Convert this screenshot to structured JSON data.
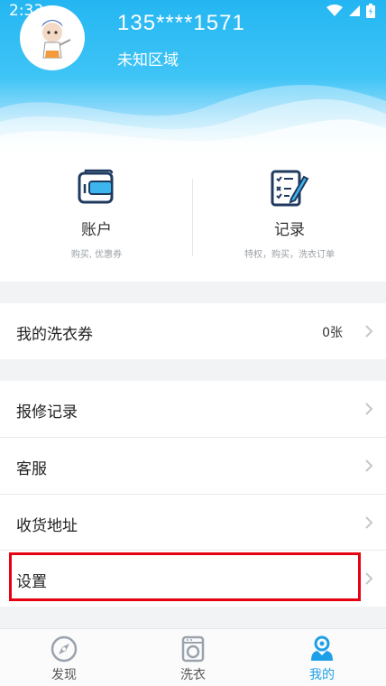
{
  "status_bar": {
    "time": "2:33"
  },
  "profile": {
    "phone": "135****1571",
    "region": "未知区域"
  },
  "shortcuts": [
    {
      "title": "账户",
      "subtitle": "购买, 优惠券",
      "icon": "wallet-icon"
    },
    {
      "title": "记录",
      "subtitle": "特权，购买，洗衣订单",
      "icon": "checklist-icon"
    }
  ],
  "coupon_row": {
    "label": "我的洗衣券",
    "value": "0张"
  },
  "menu": [
    {
      "label": "报修记录"
    },
    {
      "label": "客服"
    },
    {
      "label": "收货地址"
    },
    {
      "label": "设置"
    }
  ],
  "tabs": [
    {
      "label": "发现",
      "icon": "discover-icon",
      "active": false
    },
    {
      "label": "洗衣",
      "icon": "washer-icon",
      "active": false
    },
    {
      "label": "我的",
      "icon": "profile-icon",
      "active": true
    }
  ],
  "colors": {
    "accent": "#1ea0e8",
    "header": "#24b6f2",
    "highlight": "#e60012"
  }
}
